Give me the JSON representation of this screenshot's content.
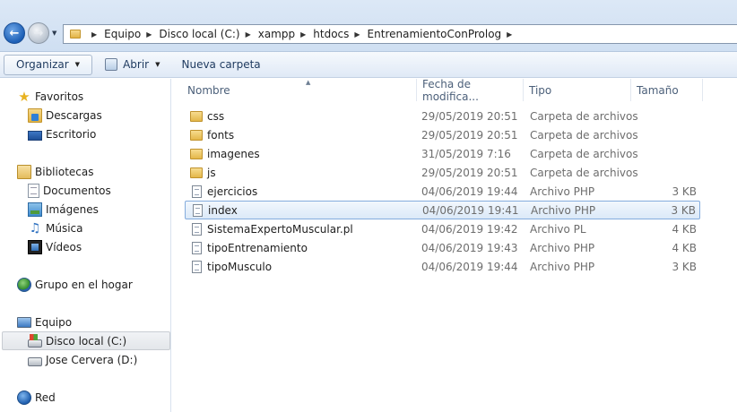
{
  "breadcrumb": [
    "Equipo",
    "Disco local (C:)",
    "xampp",
    "htdocs",
    "EntrenamientoConProlog"
  ],
  "toolbar": {
    "organize": "Organizar",
    "open": "Abrir",
    "new_folder": "Nueva carpeta"
  },
  "columns": {
    "name": "Nombre",
    "date": "Fecha de modifica...",
    "type": "Tipo",
    "size": "Tamaño"
  },
  "sidebar": {
    "favorites": {
      "label": "Favoritos",
      "items": [
        "Descargas",
        "Escritorio"
      ]
    },
    "libraries": {
      "label": "Bibliotecas",
      "items": [
        "Documentos",
        "Imágenes",
        "Música",
        "Vídeos"
      ]
    },
    "homegroup": "Grupo en el hogar",
    "computer": {
      "label": "Equipo",
      "items": [
        "Disco local (C:)",
        "Jose Cervera (D:)"
      ]
    },
    "network": "Red"
  },
  "files": [
    {
      "name": "css",
      "date": "29/05/2019 20:51",
      "type": "Carpeta de archivos",
      "size": "",
      "icon": "folder-icon"
    },
    {
      "name": "fonts",
      "date": "29/05/2019 20:51",
      "type": "Carpeta de archivos",
      "size": "",
      "icon": "folder-icon"
    },
    {
      "name": "imagenes",
      "date": "31/05/2019 7:16",
      "type": "Carpeta de archivos",
      "size": "",
      "icon": "folder-icon"
    },
    {
      "name": "js",
      "date": "29/05/2019 20:51",
      "type": "Carpeta de archivos",
      "size": "",
      "icon": "folder-icon"
    },
    {
      "name": "ejercicios",
      "date": "04/06/2019 19:44",
      "type": "Archivo PHP",
      "size": "3 KB",
      "icon": "file-icon"
    },
    {
      "name": "index",
      "date": "04/06/2019 19:41",
      "type": "Archivo PHP",
      "size": "3 KB",
      "icon": "file-icon"
    },
    {
      "name": "SistemaExpertoMuscular.pl",
      "date": "04/06/2019 19:42",
      "type": "Archivo PL",
      "size": "4 KB",
      "icon": "file-icon"
    },
    {
      "name": "tipoEntrenamiento",
      "date": "04/06/2019 19:43",
      "type": "Archivo PHP",
      "size": "4 KB",
      "icon": "file-icon"
    },
    {
      "name": "tipoMusculo",
      "date": "04/06/2019 19:44",
      "type": "Archivo PHP",
      "size": "3 KB",
      "icon": "file-icon"
    }
  ],
  "selected_file": "index",
  "selected_drive": "Disco local (C:)"
}
